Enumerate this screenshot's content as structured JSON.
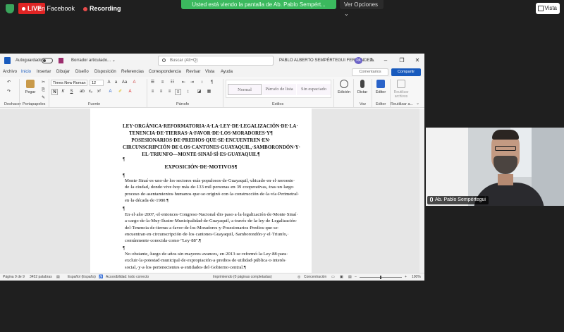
{
  "stream": {
    "live": "LIVE",
    "platform": "en Facebook",
    "recording": "Recording",
    "share_notice": "Usted está viendo la pantalla de Ab. Pablo Sempért...",
    "view_options": "Ver Opciones ⌄",
    "vista": "Vista"
  },
  "word": {
    "autosave": "Autoguardado",
    "doc_name": "Borrador articulado... ⌄",
    "search_placeholder": "Buscar (Alt+Q)",
    "user_name": "PABLO ALBERTO SEMPÉRTEGUI FERNÁNDEZ",
    "user_initials": "PA",
    "menu": [
      "Archivo",
      "Inicio",
      "Insertar",
      "Dibujar",
      "Diseño",
      "Disposición",
      "Referencias",
      "Correspondencia",
      "Revisar",
      "Vista",
      "Ayuda"
    ],
    "comments": "Comentarios",
    "share": "Compartir",
    "ribbon": {
      "font_name": "Times New Roman",
      "font_size": "12",
      "bold": "N",
      "italic": "K",
      "underline": "S",
      "paste": "Pegar",
      "styles": [
        "Normal",
        "Párrafo de lista",
        "Sin espaciado"
      ],
      "edit": "Edición",
      "dictate": "Dictar",
      "editor": "Editor",
      "reuse": "Reutilizar archivos",
      "groups": [
        "Deshacer",
        "Portapapeles",
        "Fuente",
        "Párrafo",
        "Estilos",
        "Voz",
        "Editor",
        "Reutilizar a..."
      ]
    },
    "document": {
      "title": "LEY·ORGÁNICA·REFORMATORIA·A·LA·LEY·DE·LEGALIZACIÓN·DE·LA· TENENCIA·DE·TIERRAS·A·FAVOR·DE·LOS·MORADORES·Y¶ POSESIONARIOS·DE·PREDIOS·QUE·SE·ENCUENTREN·EN· CIRCUNSCRIPCIÓN·DE·LOS·CANTONES·GUAYAQUIL,·SAMBORONDÓN·Y· EL·TRIUNFO—MONTE·SINAÍ·SÍ·ES·GUAYAQUIL¶",
      "heading": "EXPOSICIÓN·DE·MOTIVOS¶",
      "paragraphs": [
        "Monte·Sinaí·es·uno·de·los·sectores·más·populosos·de·Guayaquil,·ubicado·en·el·noroeste· de·la·ciudad,·donde·vive·hoy·más·de·133·mil·personas·en·39·cooperativas,·tras·un·largo· proceso·de·asentamientos·humanos·que·se·originó·con·la·construcción·de·la·vía·Perimetral· en·la·década·de·1980.¶",
        "En·el·año·2007,·el·entonces·Congreso·Nacional·dio·paso·a·la·legalización·de·Monte·Sinaí· a·cargo·de·la·Muy·Ilustre·Municipalidad·de·Guayaquil,·a·través·de·la·ley·de·Legalización· del·Tenencia·de·tierras·a·favor·de·los·Moradores·y·Posesionarios·Predios·que·se· encuentran·en·circunscripción·de·los·cantones·Guayaquil,·Samborondón·y·el·Triunfo,· comúnmente·conocida·como·\"Ley·88\".¶",
        "No·obstante,·luego·de·años·sin·mayores·avances,·en·2013·se·reformó·la·Ley·88·para· excluir·la·potestad·municipal·de·expropiación·a·predios·de·utilidad·pública·o·interés· social,·y·a·los·pertenecientes·a·entidades·del·Gobierno·central.¶"
      ]
    },
    "status": {
      "page": "Página 9 de 9",
      "words": "3452 palabras",
      "language": "Español (España)",
      "accessibility": "Accesibilidad: todo correcto",
      "printing": "Imprimiendo (0 páginas completadas)",
      "focus": "Concentración",
      "zoom": "100%"
    }
  },
  "camera": {
    "name": "Ab. Pablo Sempértegui"
  }
}
